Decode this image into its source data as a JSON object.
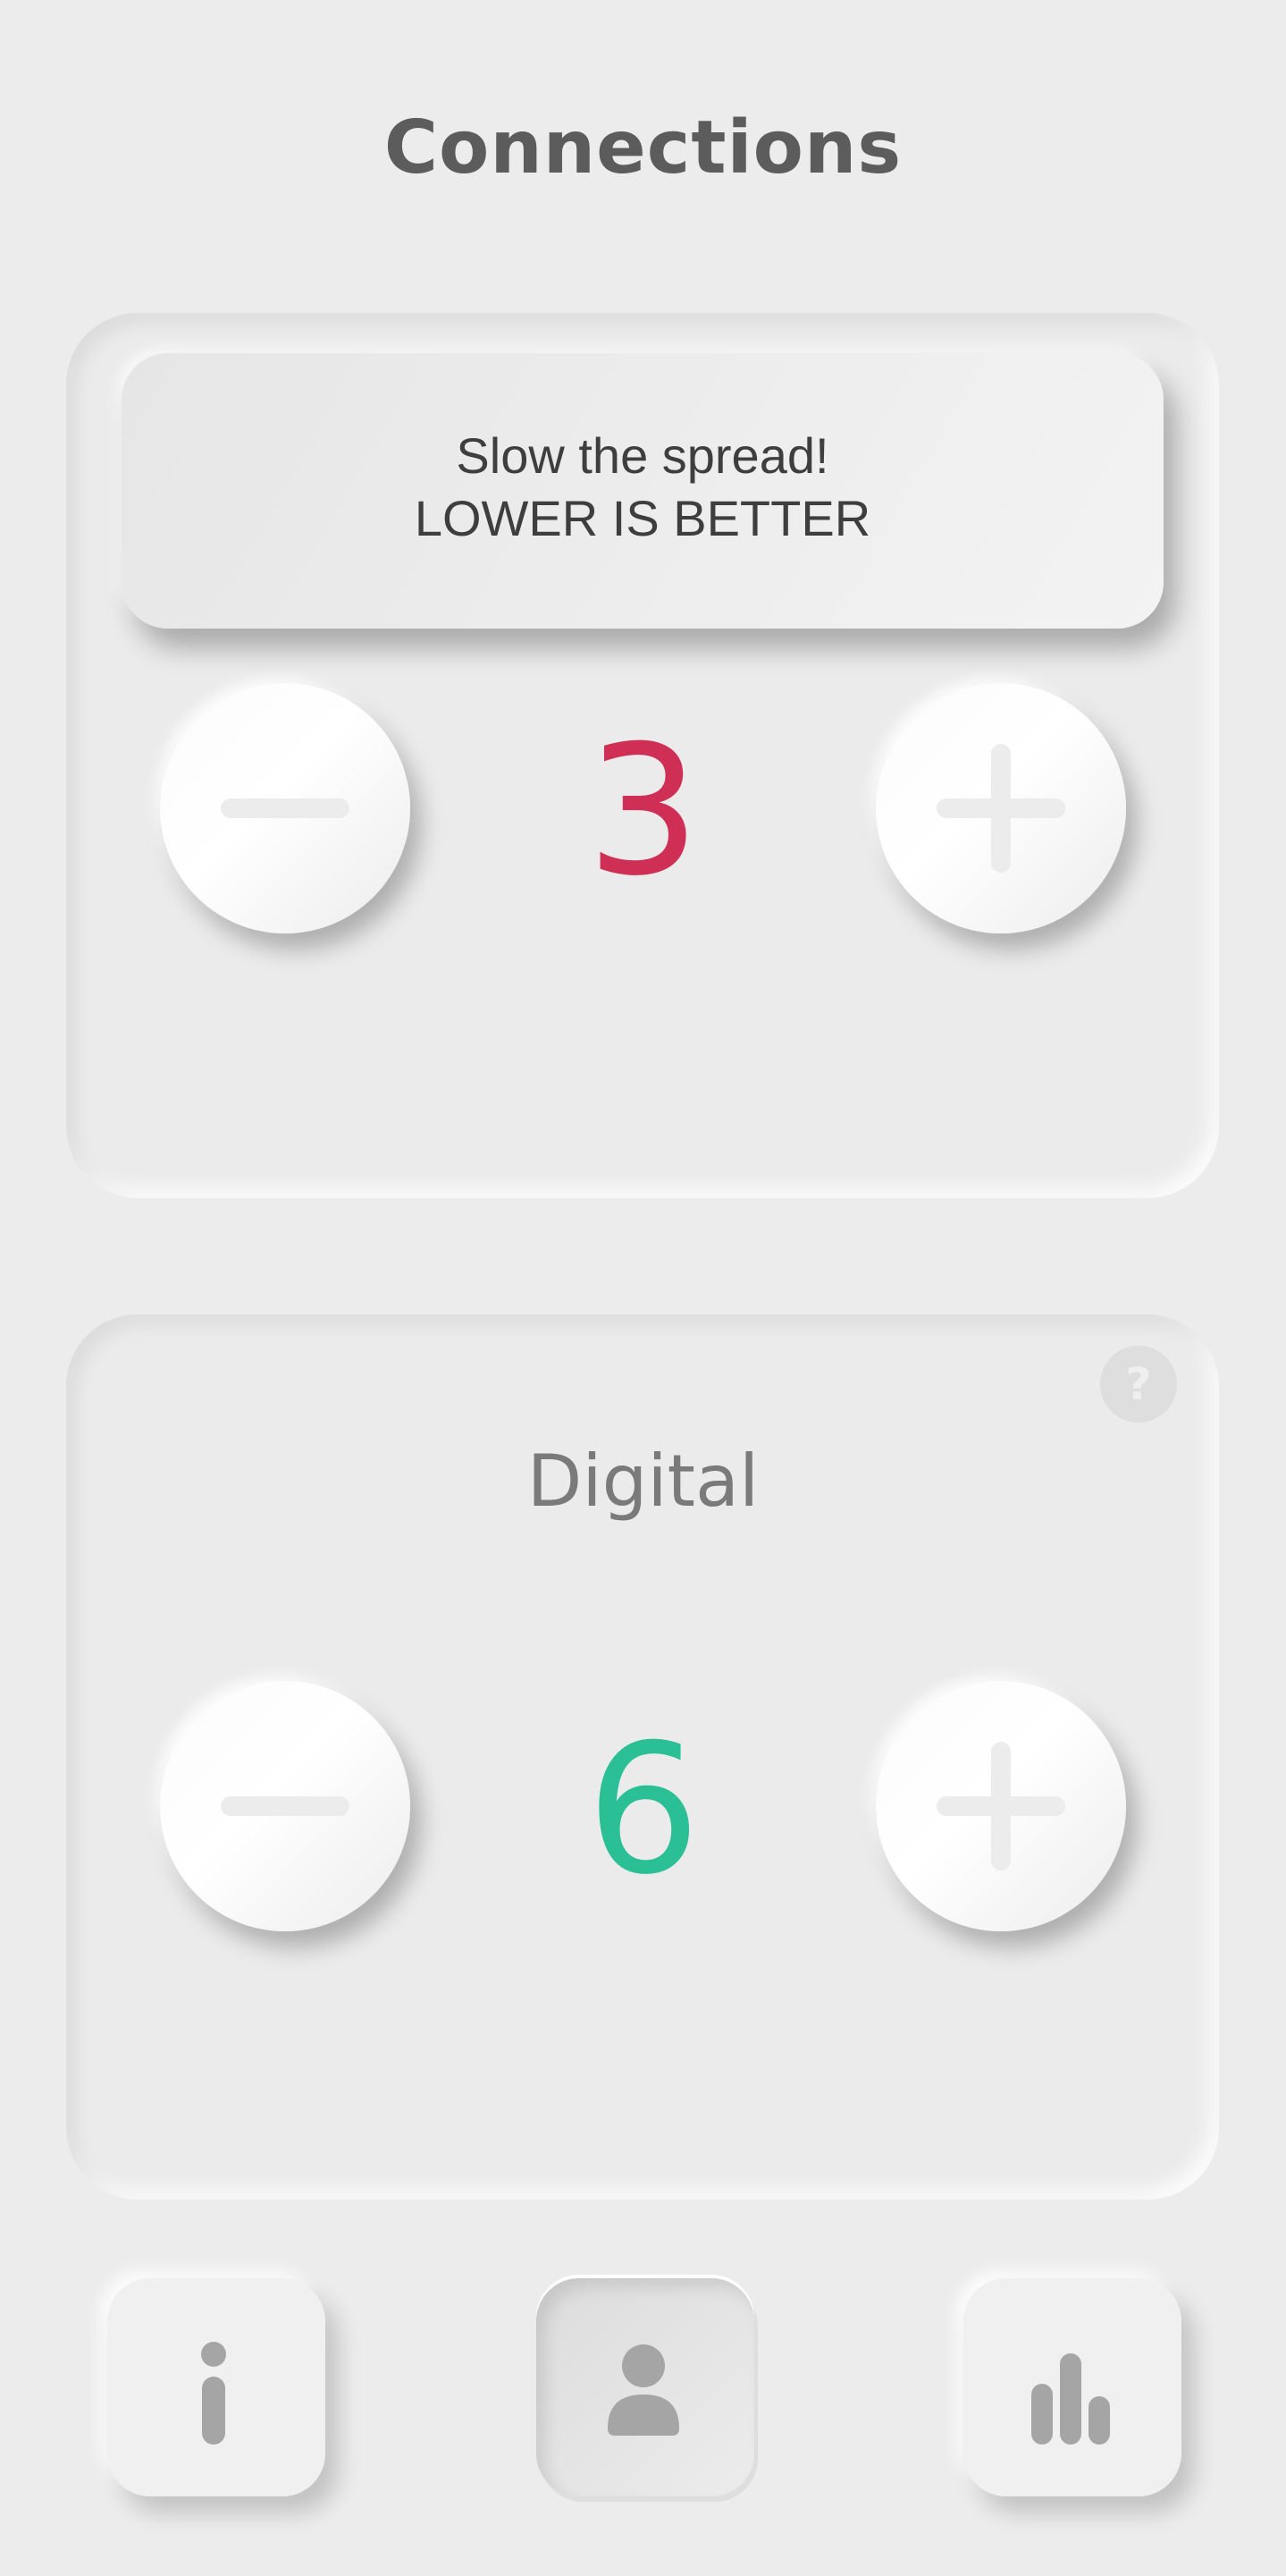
{
  "header": {
    "title": "Connections"
  },
  "physical_card": {
    "banner_line1": "Slow the spread!",
    "banner_line2": "LOWER IS BETTER",
    "count": "3",
    "count_color": "#cf2f55",
    "decrement_icon": "minus-icon",
    "increment_icon": "plus-icon"
  },
  "digital_card": {
    "label": "Digital",
    "help_label": "?",
    "count": "6",
    "count_color": "#2abf94",
    "decrement_icon": "minus-icon",
    "increment_icon": "plus-icon"
  },
  "bottom_nav": {
    "items": [
      {
        "icon": "info-icon",
        "active": false
      },
      {
        "icon": "person-icon",
        "active": true
      },
      {
        "icon": "bar-chart-icon",
        "active": false
      }
    ]
  },
  "colors": {
    "background": "#ececec",
    "title_text": "#5c5c5c",
    "icon_gray": "#a5a5a5"
  }
}
